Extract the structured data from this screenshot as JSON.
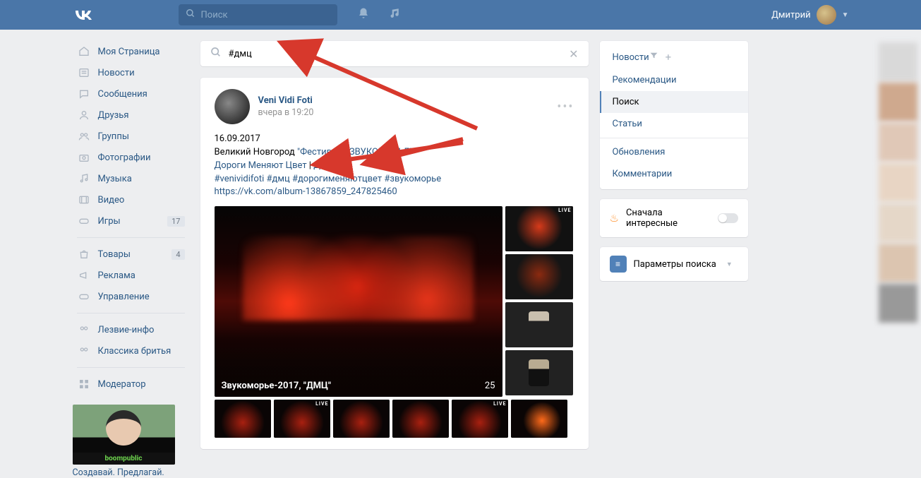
{
  "header": {
    "search_placeholder": "Поиск",
    "user_name": "Дмитрий"
  },
  "nav": {
    "items": [
      {
        "icon": "home",
        "label": "Моя Страница"
      },
      {
        "icon": "news",
        "label": "Новости"
      },
      {
        "icon": "msg",
        "label": "Сообщения"
      },
      {
        "icon": "friends",
        "label": "Друзья"
      },
      {
        "icon": "groups",
        "label": "Группы"
      },
      {
        "icon": "photo",
        "label": "Фотографии"
      },
      {
        "icon": "music",
        "label": "Музыка"
      },
      {
        "icon": "video",
        "label": "Видео"
      },
      {
        "icon": "games",
        "label": "Игры",
        "badge": "17"
      }
    ],
    "items2": [
      {
        "icon": "bag",
        "label": "Товары",
        "badge": "4"
      },
      {
        "icon": "mega",
        "label": "Реклама"
      },
      {
        "icon": "pad",
        "label": "Управление"
      }
    ],
    "items3": [
      {
        "icon": "ppl",
        "label": "Лезвие-инфо"
      },
      {
        "icon": "ppl",
        "label": "Классика бритья"
      }
    ],
    "items4": [
      {
        "icon": "grid",
        "label": "Модератор"
      }
    ],
    "promo": {
      "brand": "boompublic",
      "caption": "Создавай. Предлагай."
    }
  },
  "feed": {
    "search_value": "#дмц",
    "post": {
      "author": "Veni Vidi Foti",
      "time": "вчера в 19:20",
      "date_line": "16.09.2017",
      "desc_prefix": "Великий Новгород ",
      "desc_link": "\"Фестиваль ЗВУКОМОРЬЕ\"",
      "line3_a": "Дороги Меняют Цвет",
      "line3_sep": " | ",
      "line3_b": "ДМЦ",
      "tag1": "#venividifoti",
      "tag2": "#дмц",
      "tag3": "#дорогименяютцвет",
      "tag4": "#звукоморье",
      "album_url": "https://vk.com/album-13867859_247825460",
      "big_label": "Звукоморье-2017, \"ДМЦ\"",
      "big_count": "25"
    }
  },
  "side": {
    "tabs": [
      "Новости",
      "Рекомендации",
      "Поиск",
      "Статьи"
    ],
    "tabs2": [
      "Обновления",
      "Комментарии"
    ],
    "interesting": "Сначала интересные",
    "params": "Параметры поиска"
  }
}
